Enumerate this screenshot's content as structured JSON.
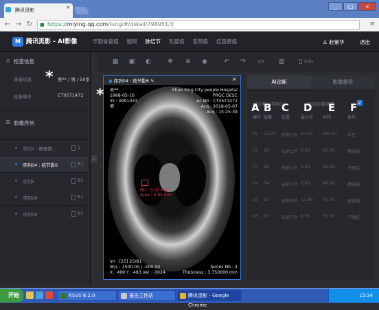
{
  "browser": {
    "tab_title": "腾讯觅影",
    "tab_close": "×",
    "url_secure": "https://",
    "url_host": "miying.qq.com",
    "url_path": "/lung/#/detail/798951/3",
    "win_min": "_",
    "win_max": "□",
    "win_close": "×"
  },
  "app": {
    "logo_text": "M",
    "brand": "腾讯觅影 - AI影像",
    "nav": [
      "早期食管癌",
      "糖网",
      "肺结节",
      "乳腺癌",
      "宫颈癌",
      "结直肠癌"
    ],
    "nav_active_index": 2,
    "user": "赵紫华",
    "logout": "退出"
  },
  "left": {
    "check_info_title": "检查信息",
    "patient_label": "患者信息",
    "patient_value": "吴** / 男 / 50岁",
    "exam_label": "检查编号",
    "exam_value": "CT0571472",
    "series_title": "影像序列",
    "series": [
      {
        "label": "序列1 : 图像数...",
        "count": "1",
        "selected": false
      },
      {
        "label": "序列04 : 结节影6",
        "count": "81",
        "selected": true
      },
      {
        "label": "序列5",
        "count": "81",
        "selected": false
      },
      {
        "label": "序列08",
        "count": "81",
        "selected": false
      },
      {
        "label": "序列09",
        "count": "81",
        "selected": false
      }
    ],
    "collapse": "‹"
  },
  "toolbar": {
    "icons": [
      "grid-layout-icon",
      "series-layout-icon",
      "window-level-icon",
      "pan-icon",
      "zoom-icon",
      "magnify-icon",
      "undo-icon",
      "redo-icon",
      "save-icon",
      "delete-icon",
      "info-icon"
    ],
    "info_label": "info"
  },
  "viewer": {
    "title": "序列04 : 结节影6",
    "close": "×",
    "top_left": [
      "吴**",
      "1968-05-16",
      "ID : 0991033",
      "男"
    ],
    "top_right": [
      "Shao Xing City people Hospital",
      "PROC DESC",
      "Ac.Nb : CT0571472",
      "Acq : 2018-05-07",
      "Acq : 15:25:39"
    ],
    "bottom_left": [
      "im : [25] 25/81",
      "W/L : 1500.00 / -500.00",
      "X : 499 Y : 493 Val : -3024"
    ],
    "bottom_right": [
      "Series Nb : 4",
      "Thickness : 3.750000 mm"
    ],
    "annotation_lines": [
      "HU : 0.00 HU",
      "Area : 4.84 mm"
    ]
  },
  "right": {
    "tabs": [
      "AI诊断",
      "影像报告"
    ],
    "active_tab": 0,
    "caption": "AI诊断 / 序列04",
    "show_label": "显示诊断结节",
    "checked": true,
    "headers": [
      "编号",
      "层面",
      "位置",
      "最长径",
      "体积",
      "类型"
    ],
    "rows": [
      [
        "01",
        "24-25",
        "右肺上叶",
        "10.00",
        "332.00",
        "实性"
      ],
      [
        "02",
        "29",
        "右肺上叶",
        "6.00",
        "52.00",
        "磨玻璃"
      ],
      [
        "03",
        "46",
        "右肺上叶",
        "6.00",
        "26.49",
        "不确定"
      ],
      [
        "04",
        "54",
        "右肺下叶",
        "6.00",
        "48.00",
        "磨玻璃"
      ],
      [
        "05",
        "59",
        "右肺中叶",
        "12.96",
        "76.30",
        "磨玻璃"
      ],
      [
        "06",
        "61",
        "右肺下叶",
        "6.95",
        "35.32",
        "不确定"
      ]
    ]
  },
  "markers": {
    "letters": [
      "A",
      "B",
      "C",
      "D",
      "E",
      "F"
    ],
    "star": "*"
  },
  "taskbar": {
    "start": "开始",
    "items": [
      {
        "label": "RSVS 8.2.0",
        "active": false
      },
      {
        "label": "报告工作站",
        "active": false
      },
      {
        "label": "腾讯觅影 - Google Chrome",
        "active": true
      }
    ],
    "clock": "15:34"
  }
}
